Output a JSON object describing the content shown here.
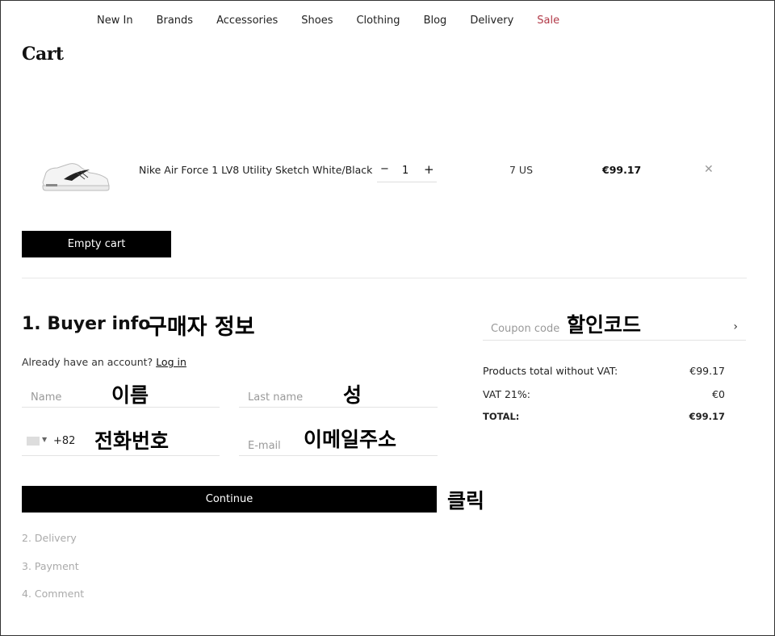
{
  "nav": {
    "items": [
      "New In",
      "Brands",
      "Accessories",
      "Shoes",
      "Clothing",
      "Blog",
      "Delivery"
    ],
    "sale": "Sale",
    "colors": {
      "sale": "#b23a48"
    }
  },
  "cart": {
    "title": "Cart",
    "item": {
      "name": "Nike Air Force 1 LV8 Utility Sketch White/Black",
      "quantity": "1",
      "size": "7 US",
      "price": "€99.17",
      "image_icon": "sneaker-image",
      "remove_icon": "close-icon"
    },
    "empty_label": "Empty cart"
  },
  "buyer": {
    "title": "1. Buyer info",
    "already": "Already have an account?",
    "login": "Log in",
    "name_placeholder": "Name",
    "last_placeholder": "Last name",
    "phone_code": "+82",
    "email_placeholder": "E-mail",
    "continue_label": "Continue"
  },
  "steps": [
    "2. Delivery",
    "3. Payment",
    "4. Comment"
  ],
  "summary": {
    "coupon_placeholder": "Coupon code",
    "rows": [
      {
        "label": "Products total without VAT:",
        "value": "€99.17"
      },
      {
        "label": "VAT 21%:",
        "value": "€0"
      },
      {
        "label": "TOTAL:",
        "value": "€99.17"
      }
    ]
  },
  "annotations": {
    "buyer": "구매자 정보",
    "name": "이름",
    "last": "성",
    "phone": "전화번호",
    "email": "이메일주소",
    "click": "클릭",
    "coupon": "할인코드"
  }
}
